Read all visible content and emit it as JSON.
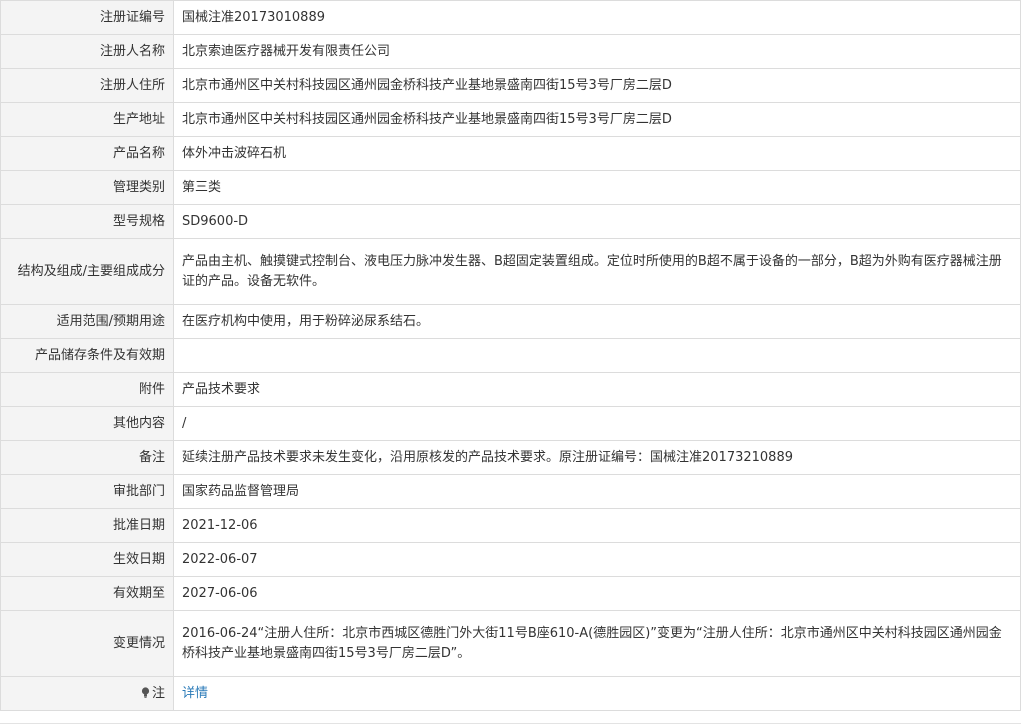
{
  "rows": [
    {
      "label": "注册证编号",
      "value": "国械注准20173010889"
    },
    {
      "label": "注册人名称",
      "value": "北京索迪医疗器械开发有限责任公司"
    },
    {
      "label": "注册人住所",
      "value": "北京市通州区中关村科技园区通州园金桥科技产业基地景盛南四街15号3号厂房二层D"
    },
    {
      "label": "生产地址",
      "value": "北京市通州区中关村科技园区通州园金桥科技产业基地景盛南四街15号3号厂房二层D"
    },
    {
      "label": "产品名称",
      "value": "体外冲击波碎石机"
    },
    {
      "label": "管理类别",
      "value": "第三类"
    },
    {
      "label": "型号规格",
      "value": "SD9600-D"
    },
    {
      "label": "结构及组成/主要组成成分",
      "value": "产品由主机、触摸键式控制台、液电压力脉冲发生器、B超固定装置组成。定位时所使用的B超不属于设备的一部分，B超为外购有医疗器械注册证的产品。设备无软件。"
    },
    {
      "label": "适用范围/预期用途",
      "value": "在医疗机构中使用，用于粉碎泌尿系结石。"
    },
    {
      "label": "产品储存条件及有效期",
      "value": ""
    },
    {
      "label": "附件",
      "value": "产品技术要求"
    },
    {
      "label": "其他内容",
      "value": "/"
    },
    {
      "label": "备注",
      "value": "延续注册产品技术要求未发生变化，沿用原核发的产品技术要求。原注册证编号：国械注准20173210889"
    },
    {
      "label": "审批部门",
      "value": "国家药品监督管理局"
    },
    {
      "label": "批准日期",
      "value": "2021-12-06"
    },
    {
      "label": "生效日期",
      "value": "2022-06-07"
    },
    {
      "label": "有效期至",
      "value": "2027-06-06"
    },
    {
      "label": "变更情况",
      "value": "2016-06-24“注册人住所：北京市西城区德胜门外大街11号B座610-A(德胜园区)”变更为“注册人住所：北京市通州区中关村科技园区通州园金桥科技产业基地景盛南四街15号3号厂房二层D”。"
    }
  ],
  "note": {
    "label": "注",
    "link": "详情",
    "icon": "lightbulb-icon"
  }
}
